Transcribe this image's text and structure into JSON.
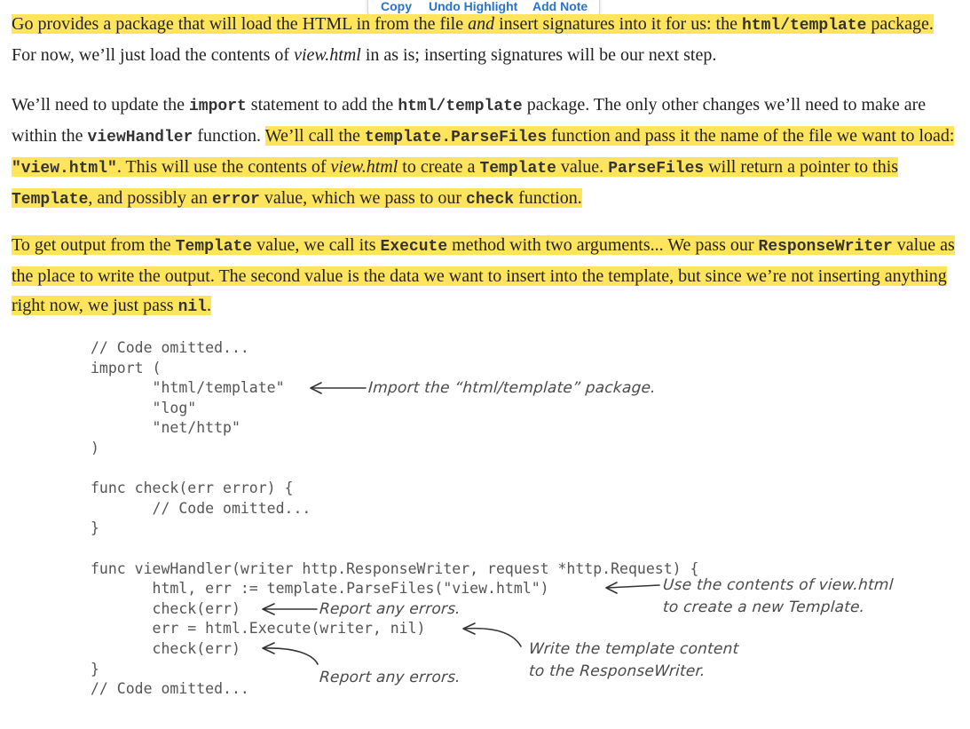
{
  "popup": {
    "copy": "Copy",
    "undo": "Undo Highlight",
    "note": "Add Note"
  },
  "p1": {
    "h_a": "Go provides a package that will load the HTML in from the file ",
    "h_and": "and",
    "h_b": " insert signatures into it for us: the ",
    "h_pkg": "html/template",
    "h_c": " package.",
    "rest_a": "For now, we’ll just load the contents of ",
    "rest_file": "view.html",
    "rest_b": " in as is; inserting signatures will be our next step."
  },
  "p2": {
    "a": "We’ll need to update the ",
    "import": "import",
    "b": " statement to add the ",
    "pkg": "html/template",
    "c": " package. The only other changes we’ll need to make are within the ",
    "handler": "viewHandler",
    "d": " function. ",
    "h1": "We’ll call the ",
    "parsefiles": "template.ParseFiles",
    "h2": " function and pass it the name of the file we want to load: ",
    "viewstr": "\"view.html\"",
    "h3": ". This will use the contents of ",
    "file": "view.html",
    "h4": " to create a ",
    "template1": "Template",
    "h5": " value. ",
    "parsefiles2": "ParseFiles",
    "h6": " will return a pointer to this ",
    "template2": "Template",
    "h7": ", and possibly an ",
    "error": "error",
    "h8": " value, which we pass to our ",
    "check": "check",
    "h9": " function."
  },
  "p3": {
    "a": "To get output from the ",
    "template": "Template",
    "b": " value, we call its ",
    "execute": "Execute",
    "c": " method with two arguments... We pass our ",
    "rw": "ResponseWriter",
    "d": " value as the place to write the output. The second value is the data we want to insert into the template, but since we’re not inserting anything right now, we just pass ",
    "nil": "nil",
    "e": "."
  },
  "code_lines": [
    "// Code omitted...",
    "import (",
    "\t\"html/template\"",
    "\t\"log\"",
    "\t\"net/http\"",
    ")",
    "",
    "func check(err error) {",
    "\t// Code omitted...",
    "}",
    "",
    "func viewHandler(writer http.ResponseWriter, request *http.Request) {",
    "\thtml, err := template.ParseFiles(\"view.html\")",
    "\tcheck(err)",
    "\terr = html.Execute(writer, nil)",
    "\tcheck(err)",
    "}",
    "// Code omitted..."
  ],
  "annotations": {
    "import_note": "Import the “html/template” package.",
    "parse_note_1": "Use the contents of view.html",
    "parse_note_2": "to create a new Template.",
    "report_1": "Report any errors.",
    "write_note_1": "Write the template content",
    "write_note_2": "to the ResponseWriter.",
    "report_2": "Report any errors."
  }
}
